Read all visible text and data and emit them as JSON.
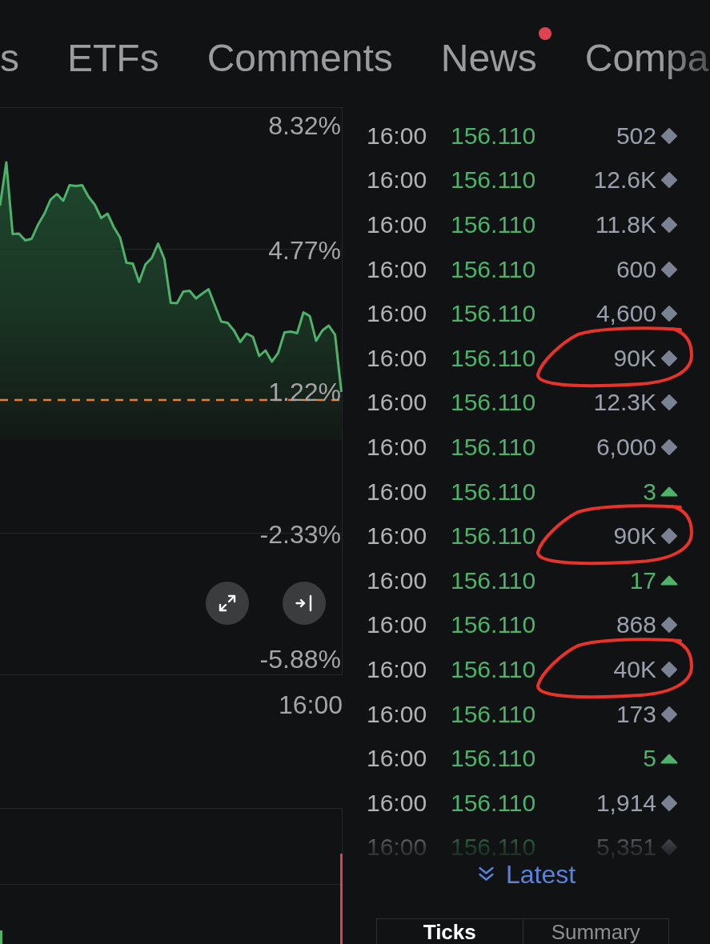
{
  "tabs": [
    {
      "label": "s",
      "selected": false,
      "dot": false
    },
    {
      "label": "ETFs",
      "selected": false,
      "dot": false
    },
    {
      "label": "Comments",
      "selected": false,
      "dot": false
    },
    {
      "label": "News",
      "selected": false,
      "dot": true
    },
    {
      "label": "Compa",
      "selected": false,
      "dot": false
    }
  ],
  "price_chart": {
    "time_label": "16:00",
    "chart_data": {
      "type": "area",
      "grid": true,
      "ylim": [
        -5.88,
        8.32
      ],
      "yticks": [
        {
          "value": 8.32,
          "label": "8.32%"
        },
        {
          "value": 4.77,
          "label": "4.77%"
        },
        {
          "value": 1.22,
          "label": "1.22%"
        },
        {
          "value": -2.33,
          "label": "-2.33%"
        },
        {
          "value": -5.88,
          "label": "-5.88%"
        }
      ],
      "values": [
        5.86,
        6.94,
        5.15,
        5.16,
        4.99,
        5.03,
        5.38,
        5.65,
        6.01,
        6.15,
        5.98,
        6.37,
        6.35,
        6.37,
        6.08,
        5.88,
        5.55,
        5.66,
        5.32,
        5.06,
        4.43,
        4.41,
        3.95,
        4.39,
        4.55,
        4.91,
        4.52,
        3.43,
        3.42,
        3.71,
        3.73,
        3.54,
        3.66,
        3.77,
        3.36,
        2.96,
        2.93,
        2.74,
        2.45,
        2.66,
        2.58,
        2.1,
        2.24,
        1.96,
        2.18,
        2.69,
        2.71,
        2.67,
        3.19,
        3.1,
        2.48,
        2.74,
        2.86,
        2.63,
        1.2
      ],
      "ref_lines": [
        {
          "axis": "y",
          "value": 1.0
        }
      ]
    }
  },
  "ticks": [
    {
      "time": "16:00",
      "price": "156.110",
      "volume": "502",
      "kind": "neutral",
      "circled": false
    },
    {
      "time": "16:00",
      "price": "156.110",
      "volume": "12.6K",
      "kind": "neutral",
      "circled": false
    },
    {
      "time": "16:00",
      "price": "156.110",
      "volume": "11.8K",
      "kind": "neutral",
      "circled": false
    },
    {
      "time": "16:00",
      "price": "156.110",
      "volume": "600",
      "kind": "neutral",
      "circled": false
    },
    {
      "time": "16:00",
      "price": "156.110",
      "volume": "4,600",
      "kind": "neutral",
      "circled": false
    },
    {
      "time": "16:00",
      "price": "156.110",
      "volume": "90K",
      "kind": "neutral",
      "circled": true
    },
    {
      "time": "16:00",
      "price": "156.110",
      "volume": "12.3K",
      "kind": "neutral",
      "circled": false
    },
    {
      "time": "16:00",
      "price": "156.110",
      "volume": "6,000",
      "kind": "neutral",
      "circled": false
    },
    {
      "time": "16:00",
      "price": "156.110",
      "volume": "3",
      "kind": "up",
      "circled": false
    },
    {
      "time": "16:00",
      "price": "156.110",
      "volume": "90K",
      "kind": "neutral",
      "circled": true
    },
    {
      "time": "16:00",
      "price": "156.110",
      "volume": "17",
      "kind": "up",
      "circled": false
    },
    {
      "time": "16:00",
      "price": "156.110",
      "volume": "868",
      "kind": "neutral",
      "circled": false
    },
    {
      "time": "16:00",
      "price": "156.110",
      "volume": "40K",
      "kind": "neutral",
      "circled": true
    },
    {
      "time": "16:00",
      "price": "156.110",
      "volume": "173",
      "kind": "neutral",
      "circled": false
    },
    {
      "time": "16:00",
      "price": "156.110",
      "volume": "5",
      "kind": "up",
      "circled": false
    },
    {
      "time": "16:00",
      "price": "156.110",
      "volume": "1,914",
      "kind": "neutral",
      "circled": false
    },
    {
      "time": "16:00",
      "price": "156.110",
      "volume": "5,351",
      "kind": "neutral",
      "circled": false
    }
  ],
  "latest_button": {
    "label": "Latest"
  },
  "bottom_tabs": [
    {
      "label": "Ticks",
      "selected": true
    },
    {
      "label": "Summary",
      "selected": false
    }
  ]
}
